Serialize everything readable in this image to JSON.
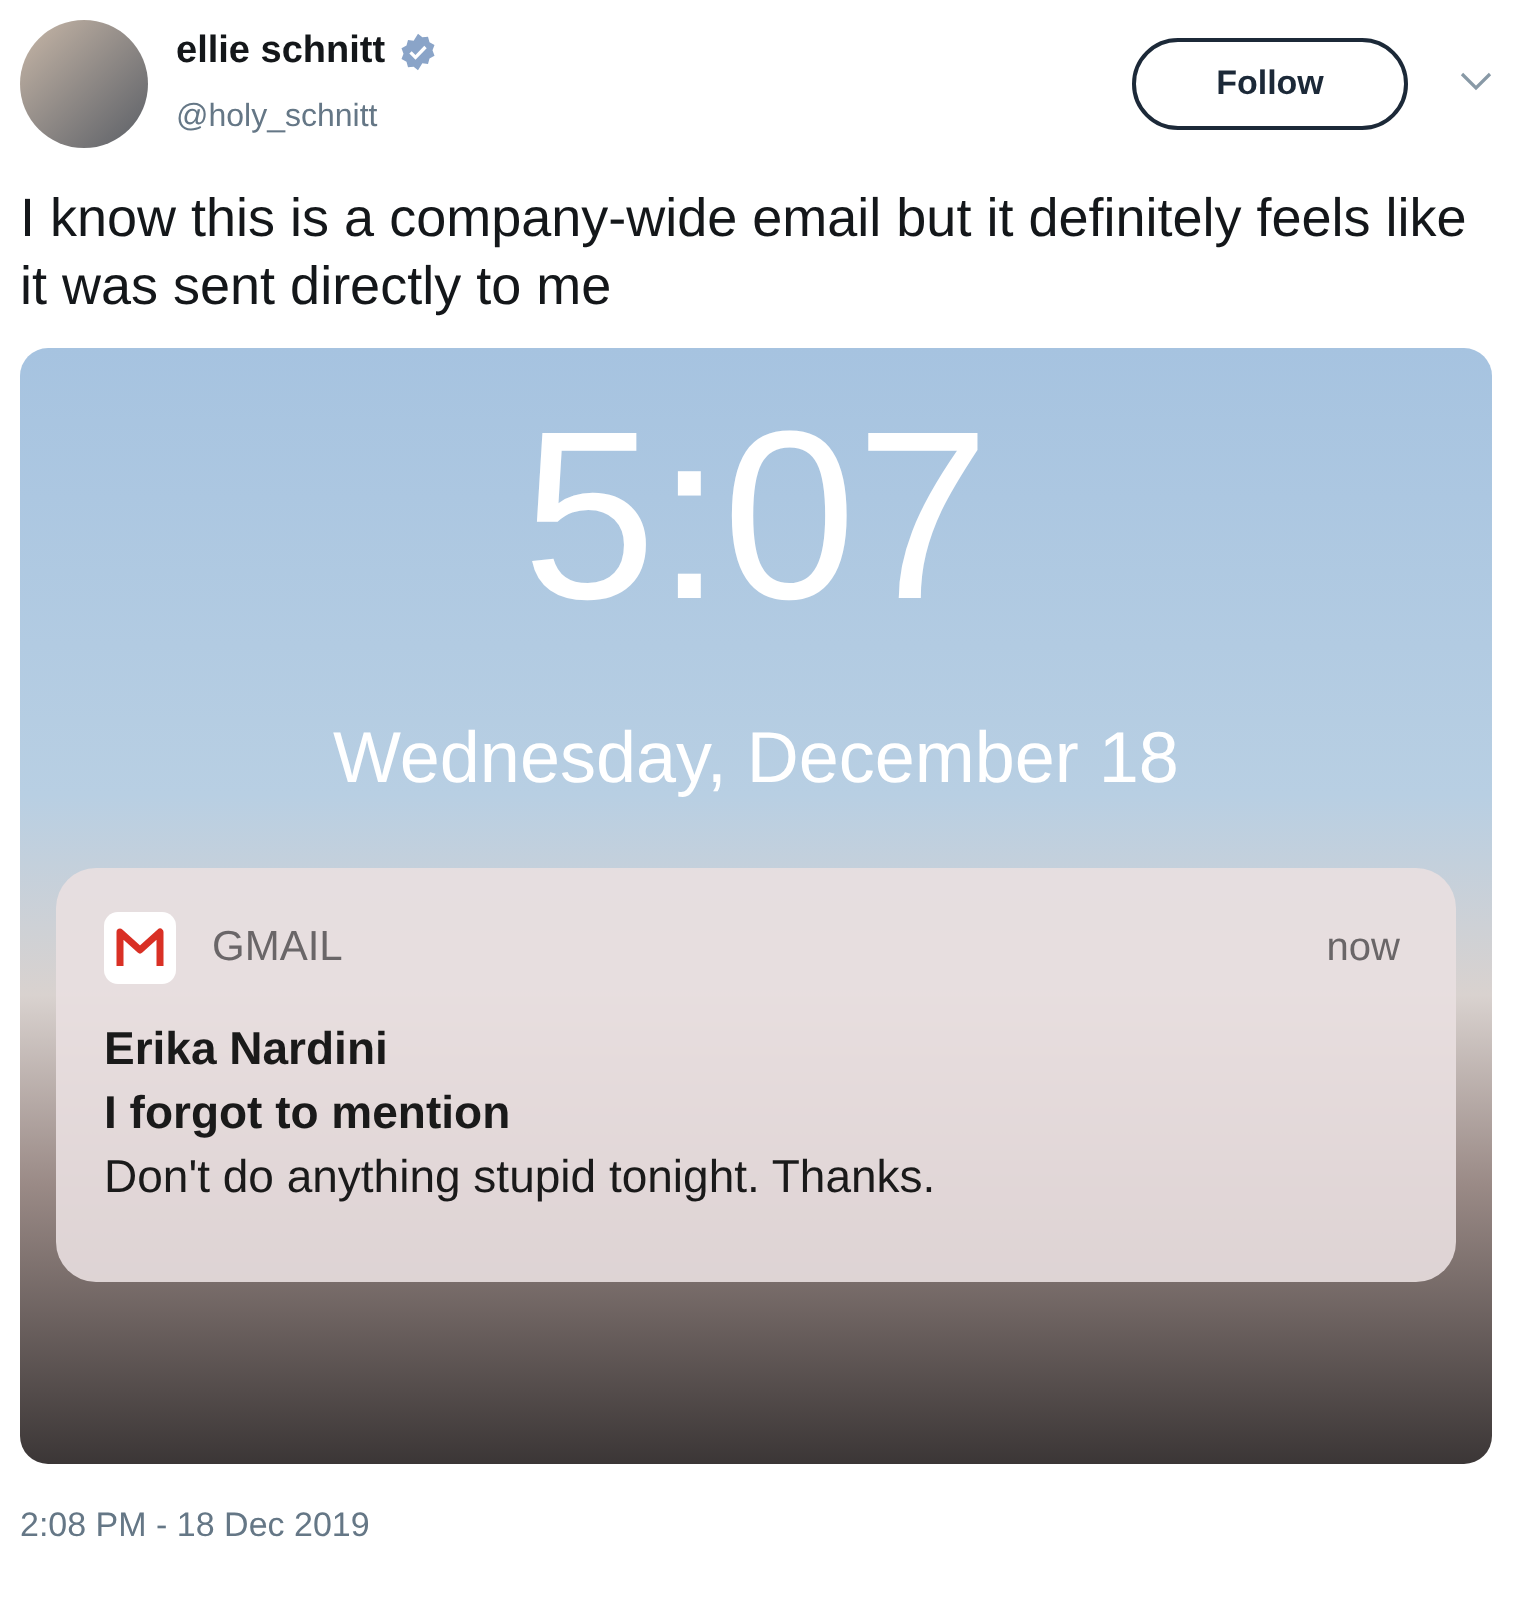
{
  "author": {
    "name": "ellie schnitt",
    "verified": true,
    "handle": "@holy_schnitt"
  },
  "follow_button": "Follow",
  "tweet_text": "I know this is a company-wide email but it definitely feels like it was sent directly to me",
  "lock_screen": {
    "time": "5:07",
    "date": "Wednesday, December 18",
    "notification": {
      "app": "GMAIL",
      "time": "now",
      "sender": "Erika Nardini",
      "subject": "I forgot to mention",
      "body": "Don't do anything stupid tonight. Thanks."
    }
  },
  "timestamp": "2:08 PM - 18 Dec 2019"
}
